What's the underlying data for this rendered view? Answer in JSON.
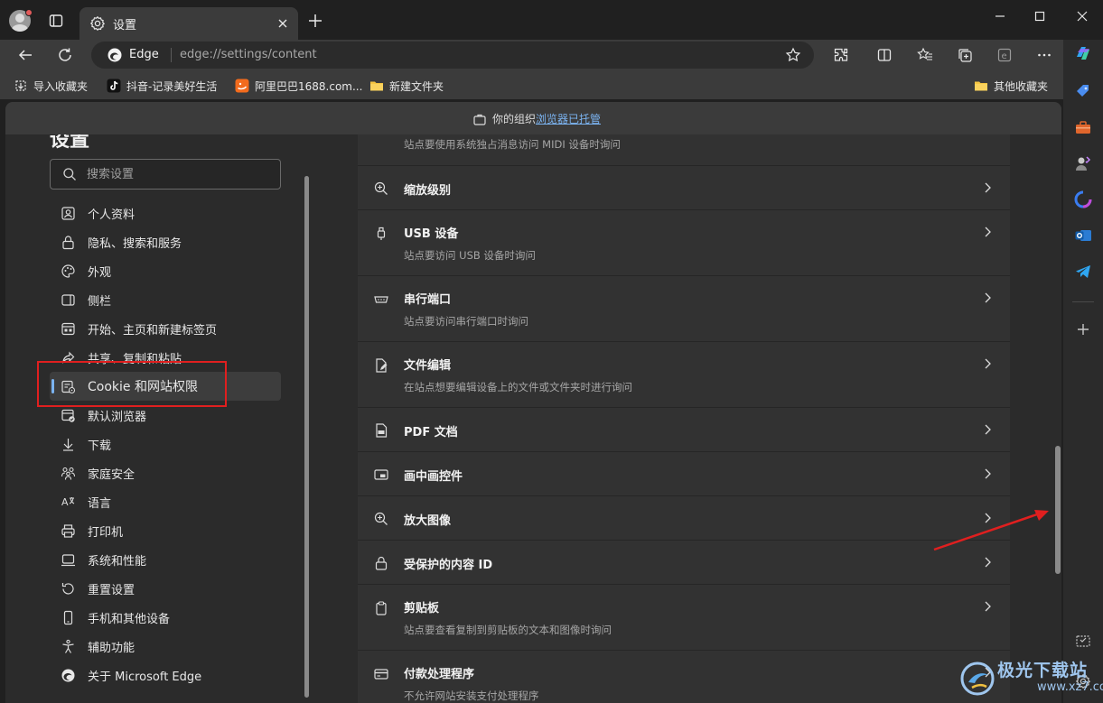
{
  "browser": {
    "tab_title": "设置",
    "edge_label": "Edge",
    "url": "edge://settings/content"
  },
  "bookmarks": [
    {
      "label": "导入收藏夹",
      "icon": "import-favorites-icon"
    },
    {
      "label": "抖音-记录美好生活",
      "icon": "douyin-icon"
    },
    {
      "label": "阿里巴巴1688.com...",
      "icon": "alibaba-icon"
    },
    {
      "label": "新建文件夹",
      "icon": "folder-icon"
    },
    {
      "label": "其他收藏夹",
      "icon": "folder-icon"
    }
  ],
  "banner": {
    "prefix": "你的组织",
    "link": "浏览器已托管"
  },
  "settings": {
    "title": "设置",
    "search_placeholder": "搜索设置",
    "nav": [
      {
        "label": "个人资料",
        "icon": "profile-icon"
      },
      {
        "label": "隐私、搜索和服务",
        "icon": "lock-icon"
      },
      {
        "label": "外观",
        "icon": "palette-icon"
      },
      {
        "label": "侧栏",
        "icon": "sidebar-icon"
      },
      {
        "label": "开始、主页和新建标签页",
        "icon": "home-icon"
      },
      {
        "label": "共享、复制和粘贴",
        "icon": "share-icon"
      },
      {
        "label": "Cookie 和网站权限",
        "icon": "cookie-site-icon"
      },
      {
        "label": "默认浏览器",
        "icon": "default-browser-icon"
      },
      {
        "label": "下载",
        "icon": "download-icon"
      },
      {
        "label": "家庭安全",
        "icon": "family-icon"
      },
      {
        "label": "语言",
        "icon": "language-icon"
      },
      {
        "label": "打印机",
        "icon": "printer-icon"
      },
      {
        "label": "系统和性能",
        "icon": "system-icon"
      },
      {
        "label": "重置设置",
        "icon": "reset-icon"
      },
      {
        "label": "手机和其他设备",
        "icon": "phone-icon"
      },
      {
        "label": "辅助功能",
        "icon": "accessibility-icon"
      },
      {
        "label": "关于 Microsoft Edge",
        "icon": "edge-icon"
      }
    ]
  },
  "content": {
    "rows": [
      {
        "title": "",
        "sub": "站点要使用系统独占消息访问 MIDI 设备时询问",
        "icon": ""
      },
      {
        "title": "缩放级别",
        "sub": "",
        "icon": "zoom-icon"
      },
      {
        "title": "USB 设备",
        "sub": "站点要访问 USB 设备时询问",
        "icon": "usb-icon"
      },
      {
        "title": "串行端口",
        "sub": "站点要访问串行端口时询问",
        "icon": "serial-port-icon"
      },
      {
        "title": "文件编辑",
        "sub": "在站点想要编辑设备上的文件或文件夹时进行询问",
        "icon": "file-edit-icon"
      },
      {
        "title": "PDF 文档",
        "sub": "",
        "icon": "pdf-icon"
      },
      {
        "title": "画中画控件",
        "sub": "",
        "icon": "pip-icon"
      },
      {
        "title": "放大图像",
        "sub": "",
        "icon": "magnify-icon"
      },
      {
        "title": "受保护的内容 ID",
        "sub": "",
        "icon": "protected-content-icon"
      },
      {
        "title": "剪贴板",
        "sub": "站点要查看复制到剪贴板的文本和图像时询问",
        "icon": "clipboard-icon"
      },
      {
        "title": "付款处理程序",
        "sub": "不允许网站安装支付处理程序",
        "icon": "payment-icon"
      }
    ]
  },
  "watermark": {
    "text": "极光下载站",
    "url": "www.xz7.com"
  },
  "colors": {
    "accent": "#7bb3f0",
    "highlight": "#e01f1f"
  }
}
